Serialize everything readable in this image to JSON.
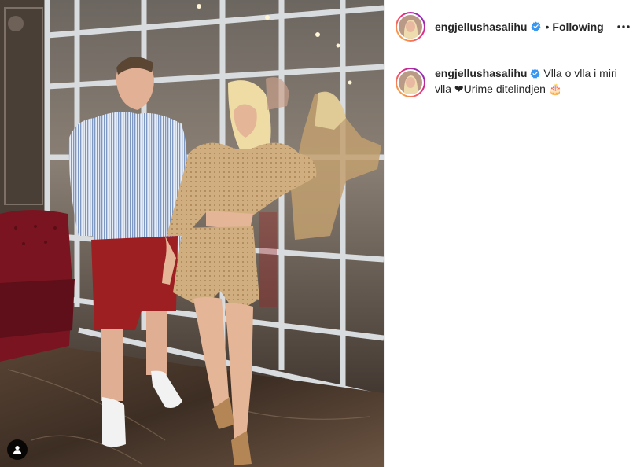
{
  "post": {
    "username": "engjellushasalihu",
    "follow_state": "Following",
    "separator": "•",
    "caption": "Vlla o vlla i miri vlla ❤Urime ditelindjen 🎂"
  },
  "colors": {
    "verified_blue": "#3897f0",
    "text": "#262626",
    "shirt_stripe": "#8fa6cc",
    "shorts_red": "#9e1f22",
    "outfit_gold": "#c9a472",
    "armchair": "#7a1420"
  },
  "icons": {
    "verified": "verified-badge-icon",
    "more": "more-options-icon",
    "user_tag": "user-tag-icon"
  }
}
